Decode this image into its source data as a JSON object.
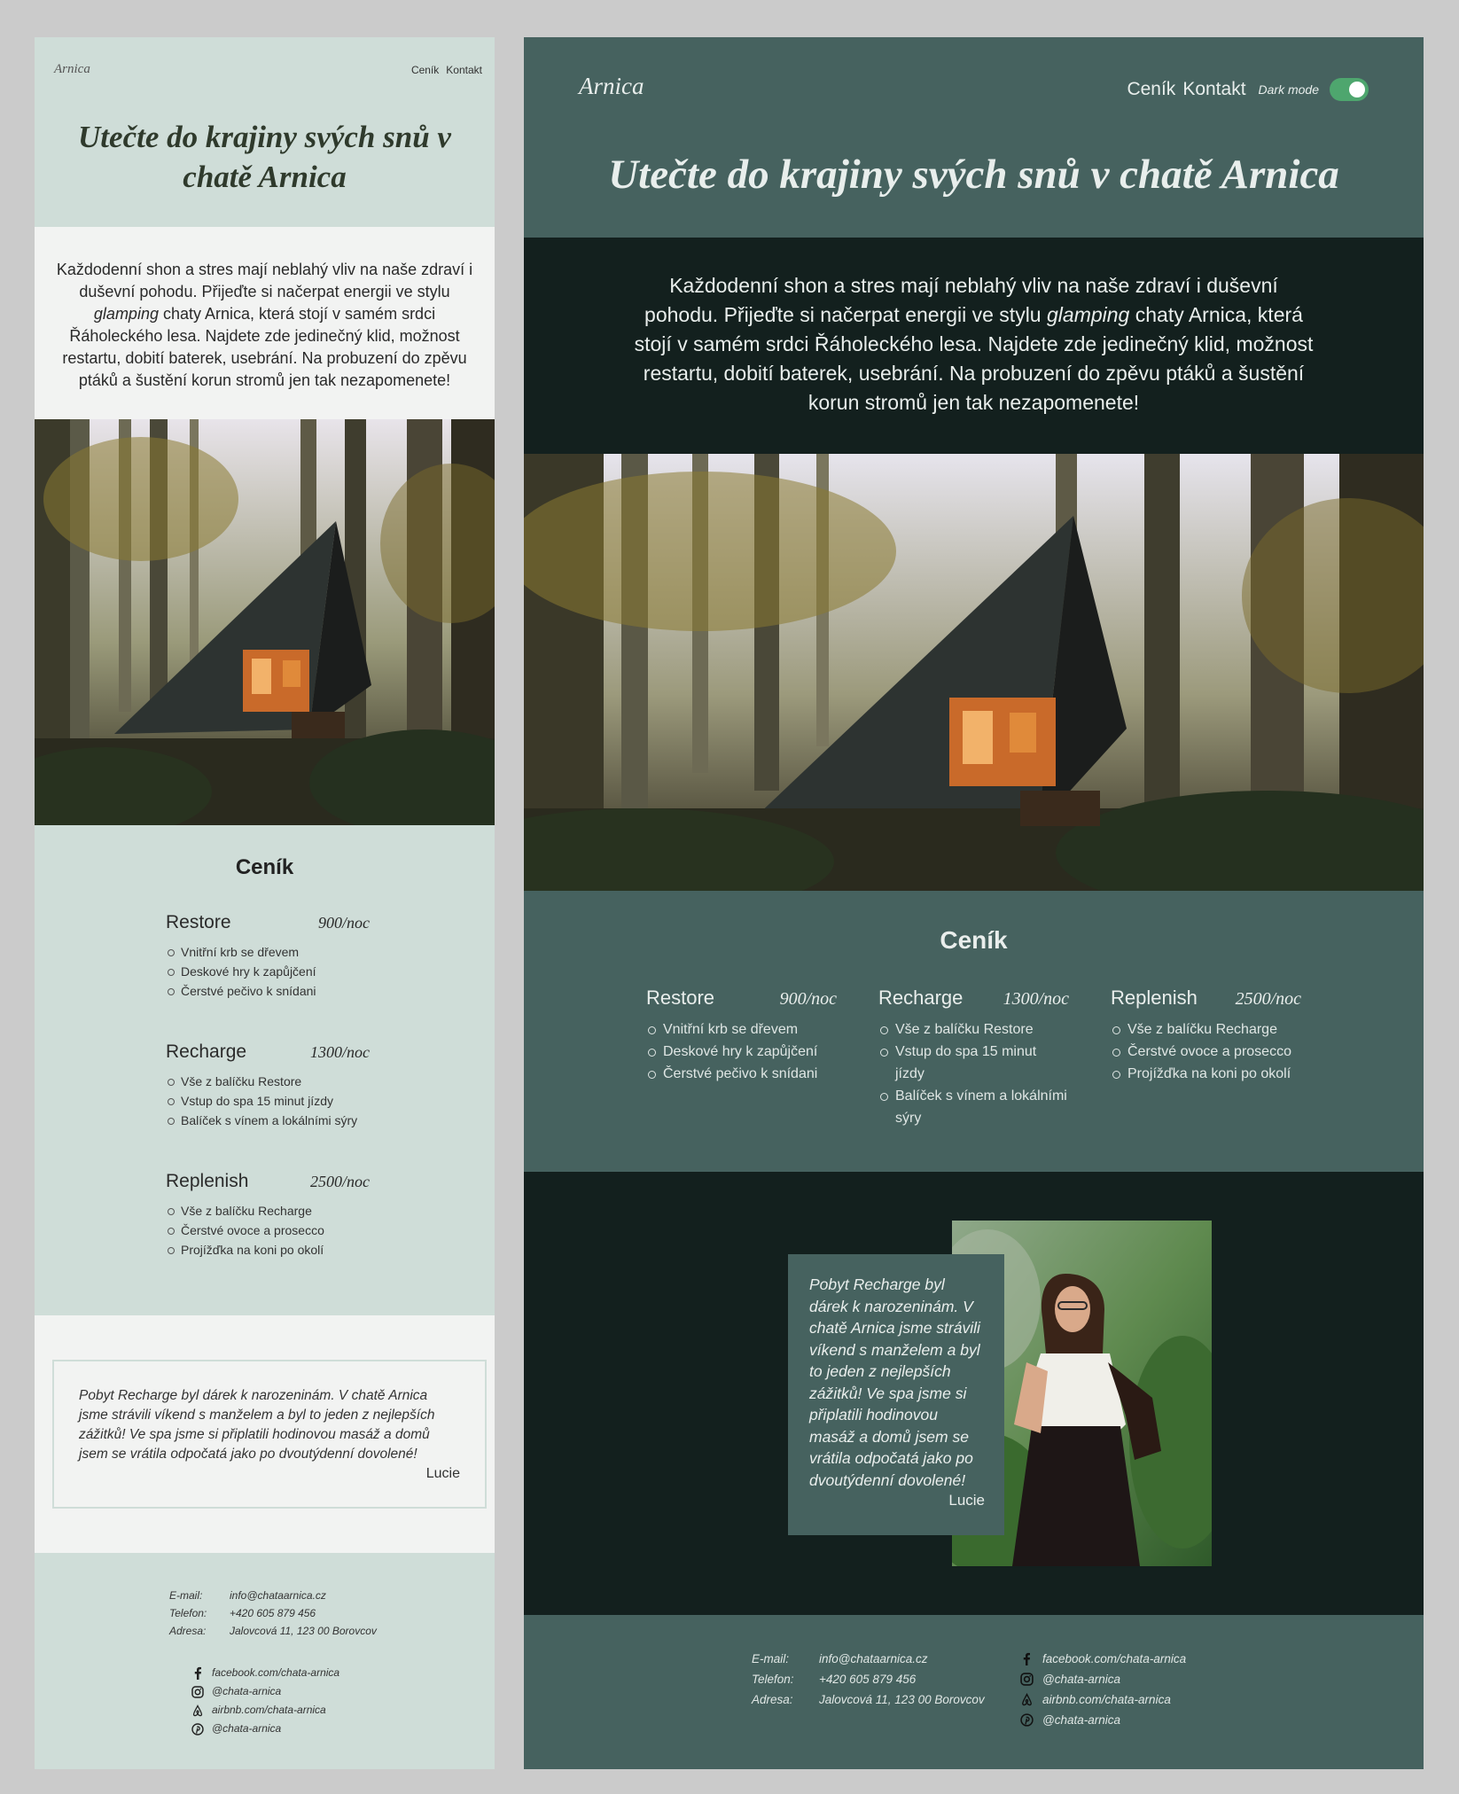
{
  "site": {
    "logo": "Arnica",
    "nav": [
      "Ceník",
      "Kontakt"
    ],
    "dark_mode_label": "Dark mode",
    "title": "Utečte do krajiny svých snů v chatě Arnica",
    "intro_before": "Každodenní shon a stres mají neblahý vliv na naše zdraví i duševní pohodu. Přijeďte si načerpat energii ve stylu ",
    "intro_em": "glamping",
    "intro_after": " chaty Arnica, která stojí v samém srdci Řáholeckého lesa. Najdete zde jedinečný klid, možnost restartu, dobití baterek, usebrání. Na probuzení do zpěvu ptáků a šustění korun stromů jen tak nezapomenete!"
  },
  "pricing": {
    "title": "Ceník",
    "packages": [
      {
        "name": "Restore",
        "price": "900/noc",
        "items": [
          "Vnitřní krb se dřevem",
          "Deskové hry k zapůjčení",
          "Čerstvé pečivo k snídani"
        ]
      },
      {
        "name": "Recharge",
        "price": "1300/noc",
        "items": [
          "Vše z balíčku Restore",
          "Vstup do spa 15 minut jízdy",
          "Balíček s vínem a lokálními sýry"
        ]
      },
      {
        "name": "Replenish",
        "price": "2500/noc",
        "items": [
          "Vše z balíčku Recharge",
          "Čerstvé ovoce a prosecco",
          "Projížďka na koni po okolí"
        ]
      }
    ]
  },
  "testimonial": {
    "quote": "Pobyt Recharge byl dárek k narozeninám. V chatě Arnica jsme strávili víkend s manželem a byl to jeden z nejlepších zážitků! Ve spa jsme si připlatili hodinovou masáž a domů jsem se vrátila odpočatá jako po dvoutýdenní dovolené!",
    "author": "Lucie"
  },
  "footer": {
    "contact": [
      {
        "label": "E-mail:",
        "value": "info@chataarnica.cz"
      },
      {
        "label": "Telefon:",
        "value": "+420 605 879 456"
      },
      {
        "label": "Adresa:",
        "value": "Jalovcová 11, 123 00 Borovcov"
      }
    ],
    "social": [
      {
        "icon": "facebook-icon",
        "text": "facebook.com/chata-arnica"
      },
      {
        "icon": "instagram-icon",
        "text": "@chata-arnica"
      },
      {
        "icon": "airbnb-icon",
        "text": "airbnb.com/chata-arnica"
      },
      {
        "icon": "pinterest-icon",
        "text": "@chata-arnica"
      }
    ]
  },
  "colors": {
    "mobile_accent": "#cfddd8",
    "mobile_light": "#f2f3f2",
    "desktop_mid": "#46625f",
    "desktop_dark": "#13201e",
    "toggle_on": "#4ea66e"
  }
}
